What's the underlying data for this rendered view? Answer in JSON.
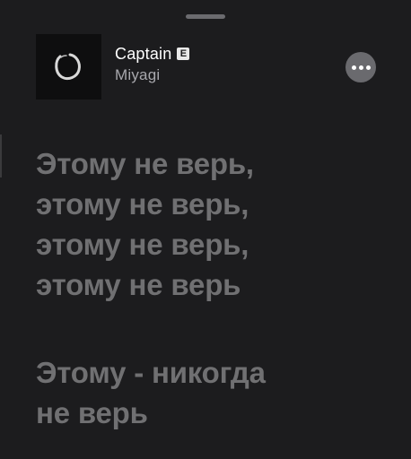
{
  "track": {
    "title": "Captain",
    "explicit_badge": "E",
    "artist": "Miyagi"
  },
  "icons": {
    "artwork": "enso-circle-artwork",
    "more": "more-horizontal-icon"
  },
  "colors": {
    "background": "#1c1c1e",
    "lyrics_inactive": "#707072",
    "artist_text": "#a8a8ad",
    "more_button": "#6a6a6e"
  },
  "lyrics": {
    "stanza_1": [
      "Этому не верь,",
      "этому не верь,",
      "этому не верь,",
      "этому не верь"
    ],
    "stanza_2": [
      "Этому - никогда",
      "не верь"
    ]
  }
}
